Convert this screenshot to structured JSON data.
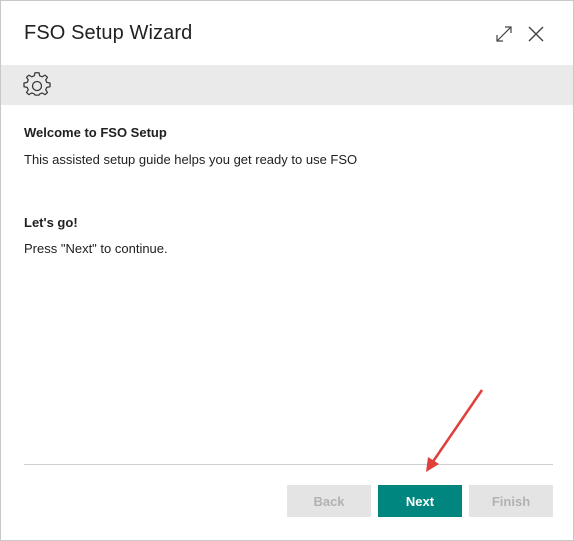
{
  "window": {
    "title": "FSO Setup Wizard",
    "expand_icon": "expand-diagonal-arrows",
    "close_icon": "close-x"
  },
  "toolbar": {
    "settings_icon": "gear"
  },
  "content": {
    "welcome_heading": "Welcome to FSO Setup",
    "welcome_text": "This assisted setup guide helps you get ready to use FSO",
    "letsgo_heading": "Let's go!",
    "letsgo_text": "Press \"Next\" to continue."
  },
  "footer": {
    "back_label": "Back",
    "next_label": "Next",
    "finish_label": "Finish",
    "back_enabled": false,
    "next_enabled": true,
    "finish_enabled": false
  },
  "annotation": {
    "arrow_color": "#e0403a",
    "points_to": "Next"
  },
  "colors": {
    "primary": "#00857f",
    "toolbar_bg": "#eaeaea",
    "disabled_bg": "#e4e4e4",
    "disabled_text": "#b2b2b2"
  }
}
